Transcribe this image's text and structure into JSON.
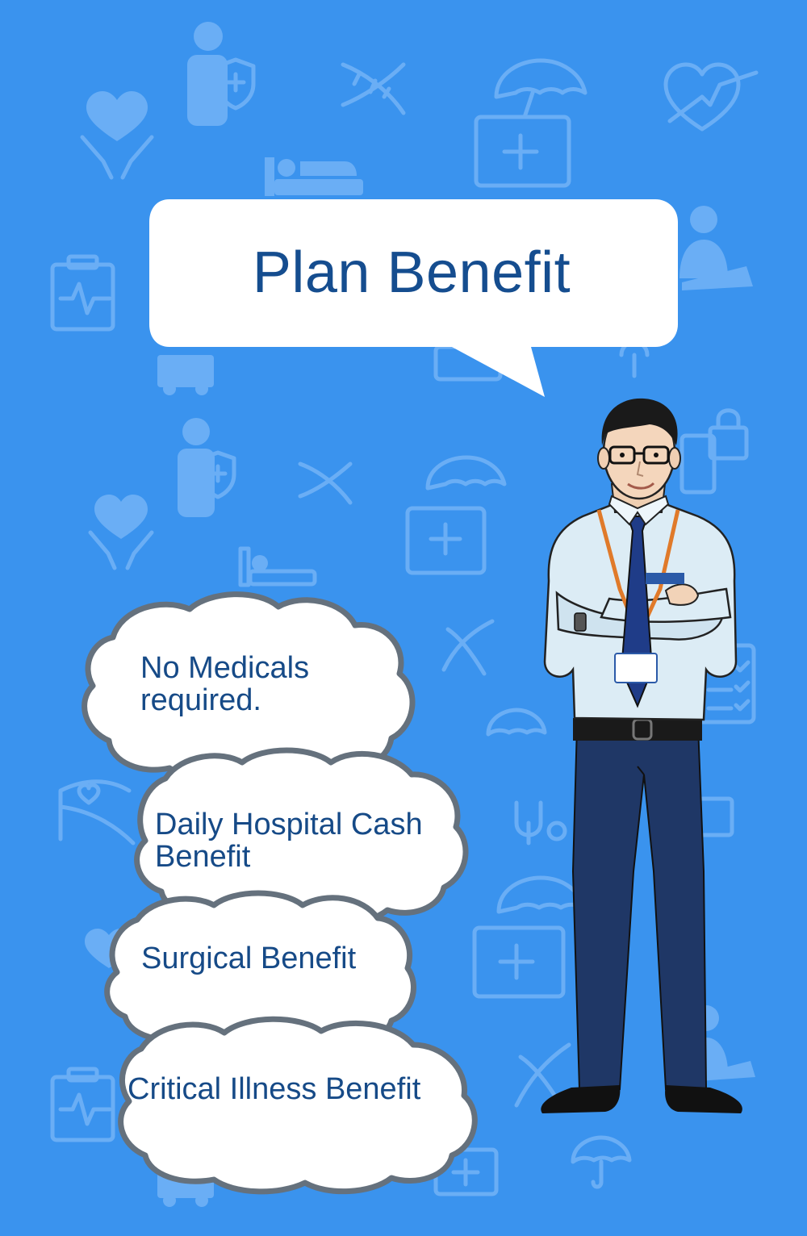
{
  "title": "Plan Benefit",
  "benefits": [
    {
      "line1": "No Medicals",
      "line2": "required."
    },
    {
      "line1": "Daily Hospital Cash",
      "line2": "Benefit"
    },
    {
      "line1": "Surgical Benefit",
      "line2": ""
    },
    {
      "line1": "Critical Illness Benefit",
      "line2": ""
    }
  ],
  "colors": {
    "background": "#3a93ee",
    "pattern": "#6aaef5",
    "title_text": "#154d8f",
    "cloud_outline": "#65717d"
  },
  "icons": [
    "person-shield-icon",
    "heart-hands-icon",
    "dna-icon",
    "medkit-umbrella-icon",
    "heart-pulse-icon",
    "hospital-bed-icon",
    "clipboard-ecg-icon",
    "ambulance-icon",
    "doctor-icon",
    "padlock-icon",
    "stethoscope-icon",
    "checklist-icon"
  ]
}
